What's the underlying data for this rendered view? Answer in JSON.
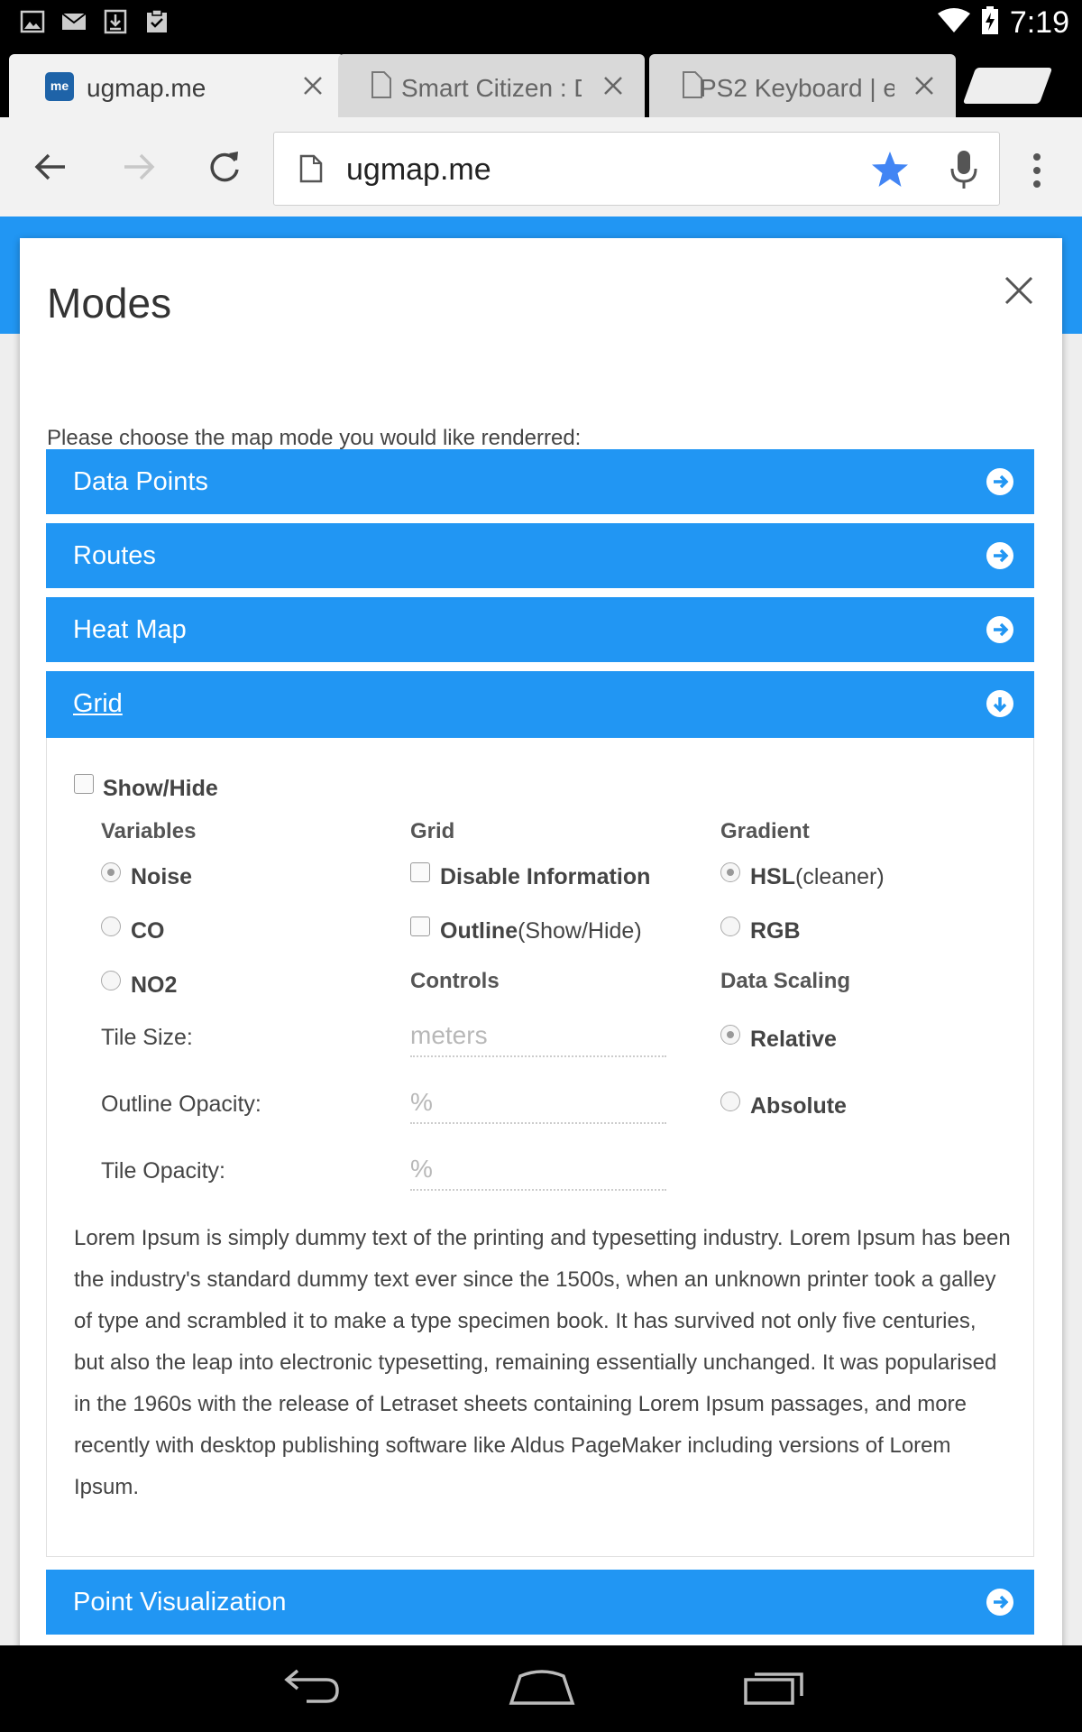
{
  "status_bar": {
    "time": "7:19",
    "icons": [
      "image-icon",
      "mail-icon",
      "download-icon",
      "clipboard-check-icon",
      "wifi-icon",
      "battery-charging-icon"
    ]
  },
  "tabs": [
    {
      "title": "ugmap.me",
      "favicon": "me"
    },
    {
      "title": "Smart Citizen : De"
    },
    {
      "title": "PS2 Keyboard | e"
    }
  ],
  "toolbar": {
    "url": "ugmap.me"
  },
  "modal": {
    "title": "Modes",
    "description": "Please choose the map mode you would like renderred:",
    "accordions": [
      {
        "label": "Data Points",
        "state": "collapsed"
      },
      {
        "label": "Routes",
        "state": "collapsed"
      },
      {
        "label": "Heat Map",
        "state": "collapsed"
      },
      {
        "label": "Grid",
        "state": "expanded"
      },
      {
        "label": "Point Visualization",
        "state": "collapsed"
      }
    ],
    "grid": {
      "show_hide": "Show/Hide",
      "variables_heading": "Variables",
      "variables": [
        {
          "label": "Noise",
          "selected": true
        },
        {
          "label": "CO",
          "selected": false
        },
        {
          "label": "NO2",
          "selected": false
        }
      ],
      "grid_heading": "Grid",
      "disable_information": "Disable Information",
      "outline_bold": "Outline",
      "outline_suffix": "(Show/Hide)",
      "controls_heading": "Controls",
      "tile_size_label": "Tile Size:",
      "tile_size_placeholder": "meters",
      "outline_opacity_label": "Outline Opacity:",
      "outline_opacity_placeholder": "%",
      "tile_opacity_label": "Tile Opacity:",
      "tile_opacity_placeholder": "%",
      "gradient_heading": "Gradient",
      "hsl_bold": "HSL",
      "hsl_suffix": "(cleaner)",
      "rgb": "RGB",
      "data_scaling_heading": "Data Scaling",
      "relative": "Relative",
      "absolute": "Absolute",
      "lorem": "Lorem Ipsum is simply dummy text of the printing and typesetting industry. Lorem Ipsum has been the industry's standard dummy text ever since the 1500s, when an unknown printer took a galley of type and scrambled it to make a type specimen book. It has survived not only five centuries, but also the leap into electronic typesetting, remaining essentially unchanged. It was popularised in the 1960s with the release of Letraset sheets containing Lorem Ipsum passages, and more recently with desktop publishing software like Aldus PageMaker including versions of Lorem Ipsum."
    }
  },
  "colors": {
    "accent": "#2196f3",
    "star": "#4285f4"
  }
}
